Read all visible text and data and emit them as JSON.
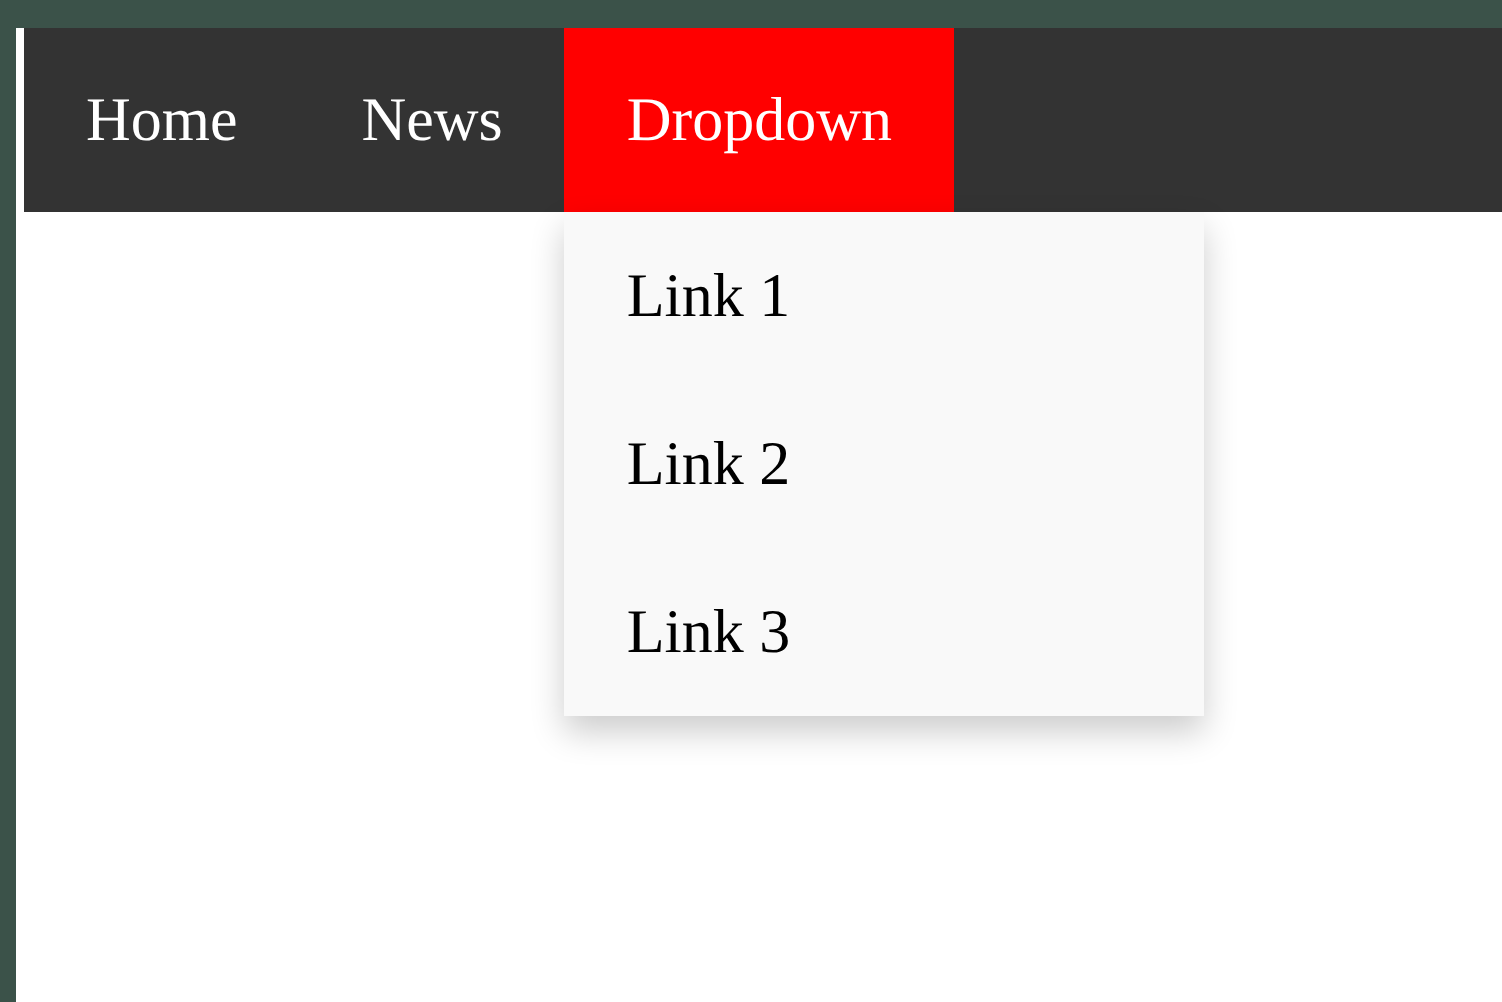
{
  "navbar": {
    "items": [
      {
        "label": "Home",
        "kind": "link",
        "selected": false
      },
      {
        "label": "News",
        "kind": "link",
        "selected": false
      },
      {
        "label": "Dropdown",
        "kind": "dropdown",
        "selected": true,
        "expanded": true,
        "links": [
          "Link 1",
          "Link 2",
          "Link 3"
        ]
      }
    ]
  }
}
